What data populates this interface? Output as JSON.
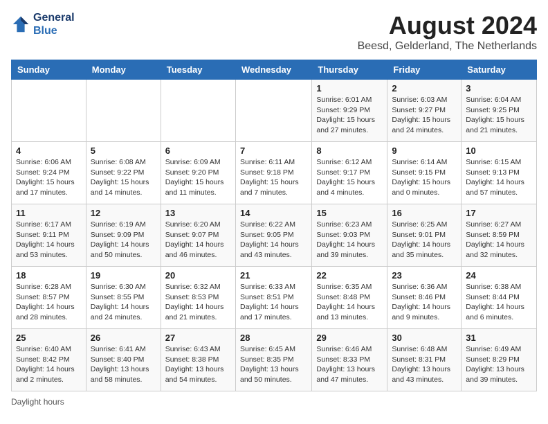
{
  "logo": {
    "line1": "General",
    "line2": "Blue"
  },
  "title": "August 2024",
  "subtitle": "Beesd, Gelderland, The Netherlands",
  "days_of_week": [
    "Sunday",
    "Monday",
    "Tuesday",
    "Wednesday",
    "Thursday",
    "Friday",
    "Saturday"
  ],
  "weeks": [
    [
      {
        "day": "",
        "info": ""
      },
      {
        "day": "",
        "info": ""
      },
      {
        "day": "",
        "info": ""
      },
      {
        "day": "",
        "info": ""
      },
      {
        "day": "1",
        "sunrise": "6:01 AM",
        "sunset": "9:29 PM",
        "daylight": "15 hours and 27 minutes."
      },
      {
        "day": "2",
        "sunrise": "6:03 AM",
        "sunset": "9:27 PM",
        "daylight": "15 hours and 24 minutes."
      },
      {
        "day": "3",
        "sunrise": "6:04 AM",
        "sunset": "9:25 PM",
        "daylight": "15 hours and 21 minutes."
      }
    ],
    [
      {
        "day": "4",
        "sunrise": "6:06 AM",
        "sunset": "9:24 PM",
        "daylight": "15 hours and 17 minutes."
      },
      {
        "day": "5",
        "sunrise": "6:08 AM",
        "sunset": "9:22 PM",
        "daylight": "15 hours and 14 minutes."
      },
      {
        "day": "6",
        "sunrise": "6:09 AM",
        "sunset": "9:20 PM",
        "daylight": "15 hours and 11 minutes."
      },
      {
        "day": "7",
        "sunrise": "6:11 AM",
        "sunset": "9:18 PM",
        "daylight": "15 hours and 7 minutes."
      },
      {
        "day": "8",
        "sunrise": "6:12 AM",
        "sunset": "9:17 PM",
        "daylight": "15 hours and 4 minutes."
      },
      {
        "day": "9",
        "sunrise": "6:14 AM",
        "sunset": "9:15 PM",
        "daylight": "15 hours and 0 minutes."
      },
      {
        "day": "10",
        "sunrise": "6:15 AM",
        "sunset": "9:13 PM",
        "daylight": "14 hours and 57 minutes."
      }
    ],
    [
      {
        "day": "11",
        "sunrise": "6:17 AM",
        "sunset": "9:11 PM",
        "daylight": "14 hours and 53 minutes."
      },
      {
        "day": "12",
        "sunrise": "6:19 AM",
        "sunset": "9:09 PM",
        "daylight": "14 hours and 50 minutes."
      },
      {
        "day": "13",
        "sunrise": "6:20 AM",
        "sunset": "9:07 PM",
        "daylight": "14 hours and 46 minutes."
      },
      {
        "day": "14",
        "sunrise": "6:22 AM",
        "sunset": "9:05 PM",
        "daylight": "14 hours and 43 minutes."
      },
      {
        "day": "15",
        "sunrise": "6:23 AM",
        "sunset": "9:03 PM",
        "daylight": "14 hours and 39 minutes."
      },
      {
        "day": "16",
        "sunrise": "6:25 AM",
        "sunset": "9:01 PM",
        "daylight": "14 hours and 35 minutes."
      },
      {
        "day": "17",
        "sunrise": "6:27 AM",
        "sunset": "8:59 PM",
        "daylight": "14 hours and 32 minutes."
      }
    ],
    [
      {
        "day": "18",
        "sunrise": "6:28 AM",
        "sunset": "8:57 PM",
        "daylight": "14 hours and 28 minutes."
      },
      {
        "day": "19",
        "sunrise": "6:30 AM",
        "sunset": "8:55 PM",
        "daylight": "14 hours and 24 minutes."
      },
      {
        "day": "20",
        "sunrise": "6:32 AM",
        "sunset": "8:53 PM",
        "daylight": "14 hours and 21 minutes."
      },
      {
        "day": "21",
        "sunrise": "6:33 AM",
        "sunset": "8:51 PM",
        "daylight": "14 hours and 17 minutes."
      },
      {
        "day": "22",
        "sunrise": "6:35 AM",
        "sunset": "8:48 PM",
        "daylight": "14 hours and 13 minutes."
      },
      {
        "day": "23",
        "sunrise": "6:36 AM",
        "sunset": "8:46 PM",
        "daylight": "14 hours and 9 minutes."
      },
      {
        "day": "24",
        "sunrise": "6:38 AM",
        "sunset": "8:44 PM",
        "daylight": "14 hours and 6 minutes."
      }
    ],
    [
      {
        "day": "25",
        "sunrise": "6:40 AM",
        "sunset": "8:42 PM",
        "daylight": "14 hours and 2 minutes."
      },
      {
        "day": "26",
        "sunrise": "6:41 AM",
        "sunset": "8:40 PM",
        "daylight": "13 hours and 58 minutes."
      },
      {
        "day": "27",
        "sunrise": "6:43 AM",
        "sunset": "8:38 PM",
        "daylight": "13 hours and 54 minutes."
      },
      {
        "day": "28",
        "sunrise": "6:45 AM",
        "sunset": "8:35 PM",
        "daylight": "13 hours and 50 minutes."
      },
      {
        "day": "29",
        "sunrise": "6:46 AM",
        "sunset": "8:33 PM",
        "daylight": "13 hours and 47 minutes."
      },
      {
        "day": "30",
        "sunrise": "6:48 AM",
        "sunset": "8:31 PM",
        "daylight": "13 hours and 43 minutes."
      },
      {
        "day": "31",
        "sunrise": "6:49 AM",
        "sunset": "8:29 PM",
        "daylight": "13 hours and 39 minutes."
      }
    ]
  ],
  "footer": "Daylight hours"
}
